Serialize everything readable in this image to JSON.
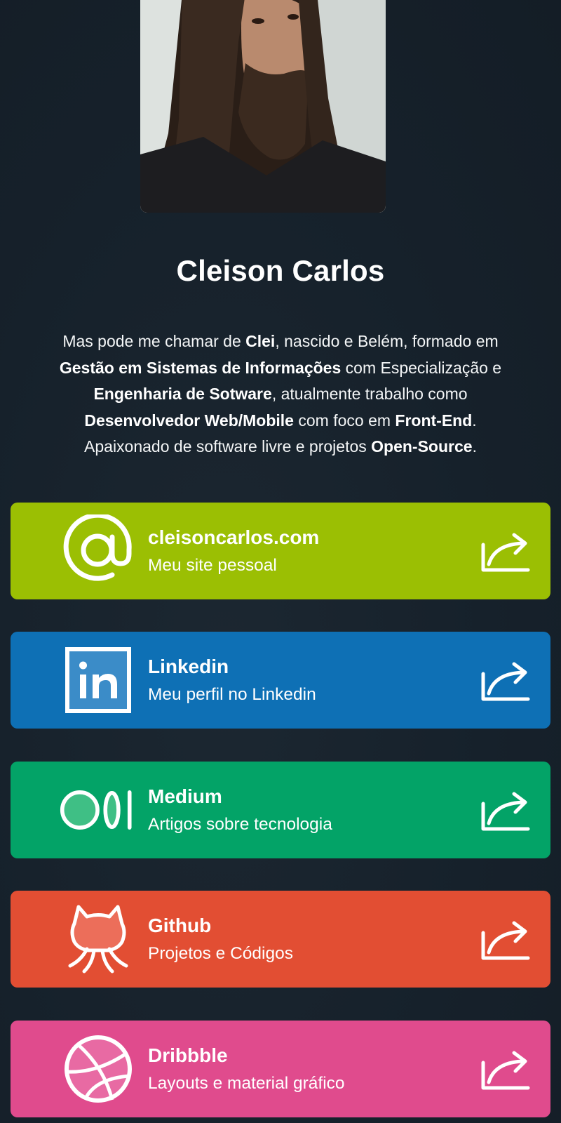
{
  "profile": {
    "name": "Cleison Carlos",
    "bio": [
      [
        {
          "t": "Mas pode me chamar de "
        },
        {
          "t": "Clei",
          "b": true
        },
        {
          "t": ", nascido e Belém, formado em"
        }
      ],
      [
        {
          "t": "Gestão em Sistemas de Informações",
          "b": true
        },
        {
          "t": " com Especialização e"
        }
      ],
      [
        {
          "t": "Engenharia de Sotware",
          "b": true
        },
        {
          "t": ", atualmente trabalho como"
        }
      ],
      [
        {
          "t": "Desenvolvedor Web/Mobile",
          "b": true
        },
        {
          "t": " com foco em "
        },
        {
          "t": "Front-End",
          "b": true
        },
        {
          "t": "."
        }
      ],
      [
        {
          "t": "Apaixonado de software livre e projetos "
        },
        {
          "t": "Open-Source",
          "b": true
        },
        {
          "t": "."
        }
      ]
    ]
  },
  "links": [
    {
      "title": "cleisoncarlos.com",
      "subtitle": "Meu site pessoal",
      "icon": "at-sign-icon",
      "color": "#9bbf03"
    },
    {
      "title": "Linkedin",
      "subtitle": "Meu perfil no Linkedin",
      "icon": "linkedin-icon",
      "color": "#0e70b5"
    },
    {
      "title": "Medium",
      "subtitle": "Artigos sobre tecnologia",
      "icon": "medium-icon",
      "color": "#03a367"
    },
    {
      "title": "Github",
      "subtitle": "Projetos e Códigos",
      "icon": "github-icon",
      "color": "#e24e33"
    },
    {
      "title": "Dribbble",
      "subtitle": "Layouts e material gráfico",
      "icon": "dribbble-icon",
      "color": "#e04b8d"
    }
  ],
  "share_icon": "share-icon"
}
